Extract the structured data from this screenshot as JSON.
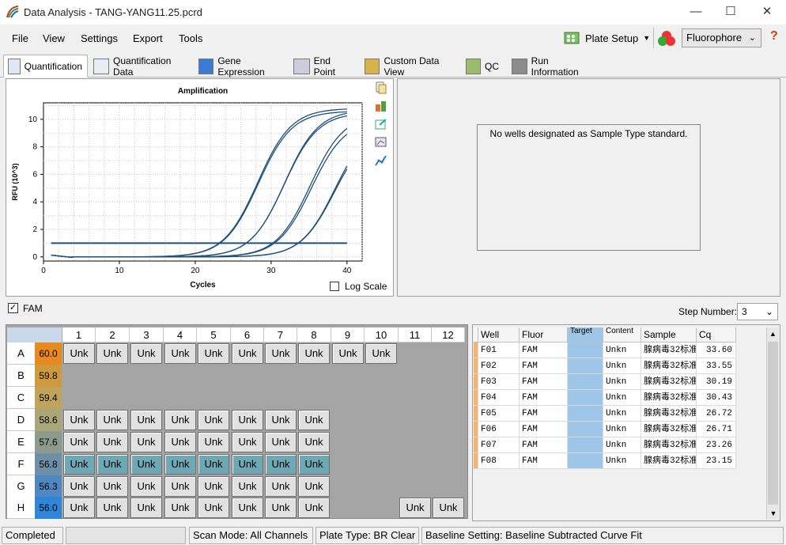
{
  "window": {
    "title": "Data Analysis - TANG-YANG11.25.pcrd",
    "minimize": "—",
    "maximize": "☐",
    "close": "✕"
  },
  "menu": {
    "file": "File",
    "view": "View",
    "settings": "Settings",
    "export": "Export",
    "tools": "Tools"
  },
  "toolbar": {
    "plate_setup": "Plate Setup",
    "fluorophore": "Fluorophore",
    "help": "?"
  },
  "tabs": [
    "Quantification",
    "Quantification Data",
    "Gene Expression",
    "End Point",
    "Custom Data View",
    "QC",
    "Run Information"
  ],
  "standard_panel": {
    "message": "No wells designated as Sample Type standard."
  },
  "log_scale_label": "Log Scale",
  "fam_label": "FAM",
  "step_number": {
    "label": "Step Number:",
    "value": "3"
  },
  "chart_data": {
    "type": "line",
    "title": "Amplification",
    "xlabel": "Cycles",
    "ylabel": "RFU (10^3)",
    "xlim": [
      0,
      42
    ],
    "ylim": [
      -0.3,
      11.2
    ],
    "xticks": [
      0,
      10,
      20,
      30,
      40
    ],
    "yticks": [
      0,
      2,
      4,
      6,
      8,
      10
    ],
    "threshold": 1.0,
    "grid": true,
    "series_params": [
      {
        "cq": 23.15,
        "plateau": 10.8
      },
      {
        "cq": 23.26,
        "plateau": 10.6
      },
      {
        "cq": 26.71,
        "plateau": 10.5
      },
      {
        "cq": 26.72,
        "plateau": 10.7
      },
      {
        "cq": 30.19,
        "plateau": 10.4
      },
      {
        "cq": 30.43,
        "plateau": 10.0
      },
      {
        "cq": 33.55,
        "plateau": 9.8
      },
      {
        "cq": 33.6,
        "plateau": 9.4
      }
    ]
  },
  "plate": {
    "columns": [
      "1",
      "2",
      "3",
      "4",
      "5",
      "6",
      "7",
      "8",
      "9",
      "10",
      "11",
      "12"
    ],
    "rows": [
      {
        "label": "A",
        "temp": "60.0",
        "color": "#e98a1e",
        "wells": [
          1,
          2,
          3,
          4,
          5,
          6,
          7,
          8,
          9,
          10
        ]
      },
      {
        "label": "B",
        "temp": "59.8",
        "color": "#cf9a3e",
        "wells": []
      },
      {
        "label": "C",
        "temp": "59.4",
        "color": "#c0a45c",
        "wells": []
      },
      {
        "label": "D",
        "temp": "58.6",
        "color": "#aaa677",
        "wells": [
          1,
          2,
          3,
          4,
          5,
          6,
          7,
          8
        ]
      },
      {
        "label": "E",
        "temp": "57.6",
        "color": "#8d9a8e",
        "wells": [
          1,
          2,
          3,
          4,
          5,
          6,
          7,
          8
        ]
      },
      {
        "label": "F",
        "temp": "56.8",
        "color": "#6f8fa8",
        "wells": [
          1,
          2,
          3,
          4,
          5,
          6,
          7,
          8
        ]
      },
      {
        "label": "G",
        "temp": "56.3",
        "color": "#4f88c2",
        "wells": [
          1,
          2,
          3,
          4,
          5,
          6,
          7,
          8
        ]
      },
      {
        "label": "H",
        "temp": "56.0",
        "color": "#2f86d8",
        "wells": [
          1,
          2,
          3,
          4,
          5,
          6,
          7,
          8,
          11,
          12
        ]
      }
    ],
    "well_label": "Unk",
    "selected_row": "F"
  },
  "data_table": {
    "headers": [
      "Well",
      "Fluor",
      "Target",
      "Content",
      "Sample",
      "Cq"
    ],
    "rows": [
      [
        "F01",
        "FAM",
        "",
        "Unkn",
        "腺病毒32标准",
        "33.60"
      ],
      [
        "F02",
        "FAM",
        "",
        "Unkn",
        "腺病毒32标准",
        "33.55"
      ],
      [
        "F03",
        "FAM",
        "",
        "Unkn",
        "腺病毒32标准",
        "30.19"
      ],
      [
        "F04",
        "FAM",
        "",
        "Unkn",
        "腺病毒32标准",
        "30.43"
      ],
      [
        "F05",
        "FAM",
        "",
        "Unkn",
        "腺病毒32标准",
        "26.72"
      ],
      [
        "F06",
        "FAM",
        "",
        "Unkn",
        "腺病毒32标准",
        "26.71"
      ],
      [
        "F07",
        "FAM",
        "",
        "Unkn",
        "腺病毒32标准",
        "23.26"
      ],
      [
        "F08",
        "FAM",
        "",
        "Unkn",
        "腺病毒32标准",
        "23.15"
      ]
    ]
  },
  "status": {
    "state": "Completed",
    "scan_mode": "Scan Mode: All Channels",
    "plate_type": "Plate Type: BR Clear",
    "baseline": "Baseline Setting: Baseline Subtracted Curve Fit"
  }
}
